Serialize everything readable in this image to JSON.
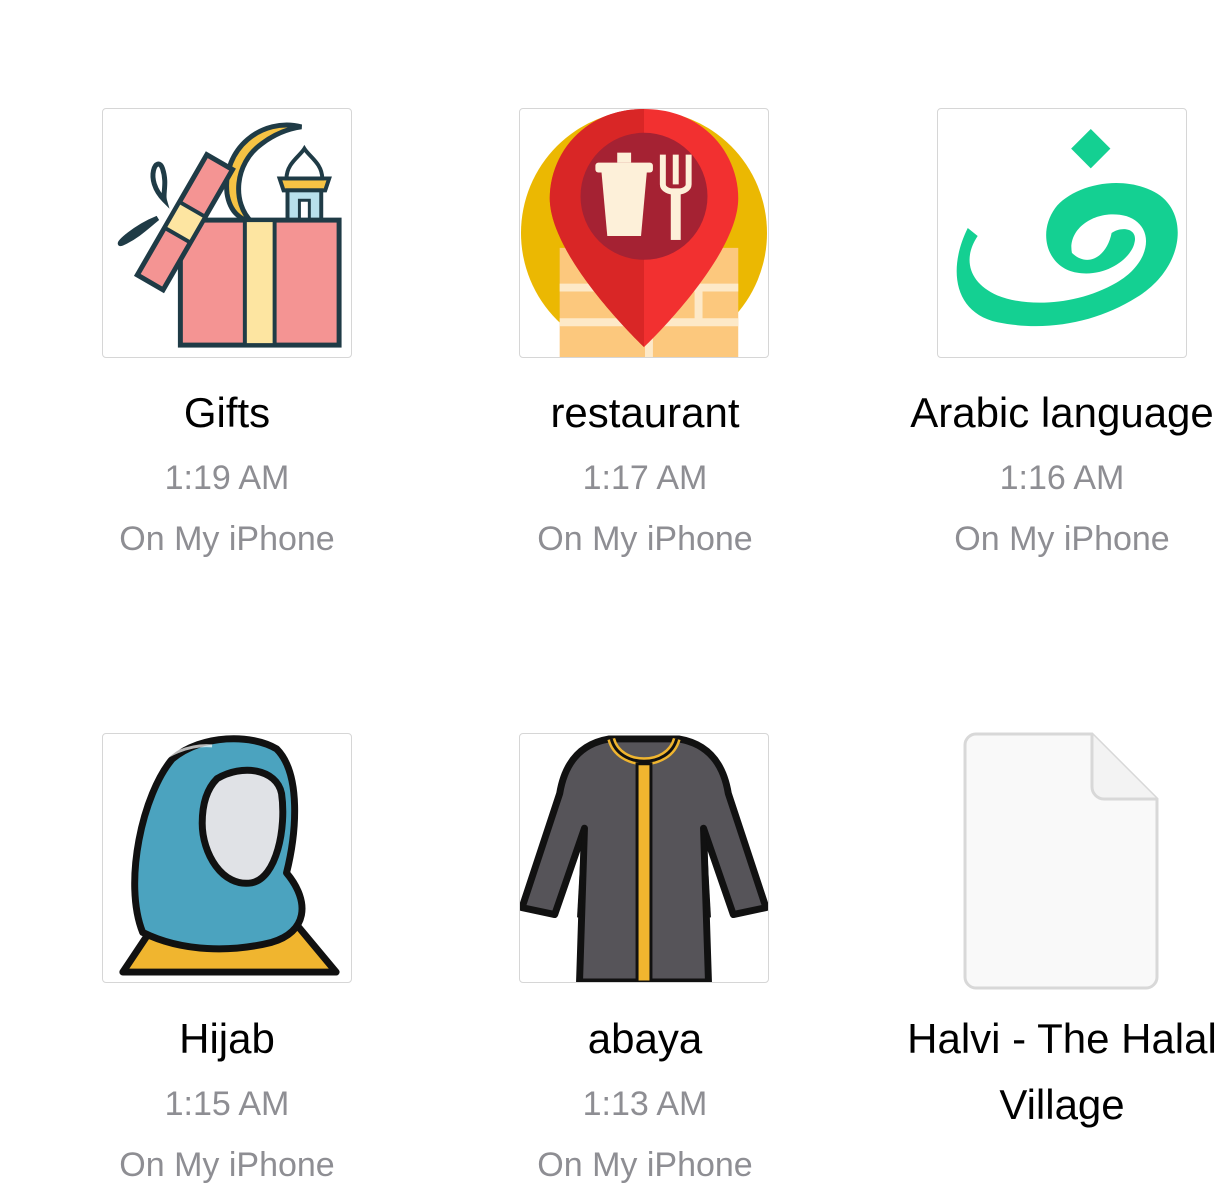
{
  "files": [
    {
      "name": "Gifts",
      "time": "1:19 AM",
      "location": "On My iPhone",
      "thumb_icon": "gift-ramadan-icon"
    },
    {
      "name": "restaurant",
      "time": "1:17 AM",
      "location": "On My iPhone",
      "thumb_icon": "restaurant-pin-icon"
    },
    {
      "name": "Arabic language",
      "time": "1:16 AM",
      "location": "On My iPhone",
      "thumb_icon": "arabic-letter-dad-icon"
    },
    {
      "name": "Hijab",
      "time": "1:15 AM",
      "location": "On My iPhone",
      "thumb_icon": "hijab-woman-icon"
    },
    {
      "name": "abaya",
      "time": "1:13 AM",
      "location": "On My iPhone",
      "thumb_icon": "abaya-robe-icon"
    },
    {
      "name_line1": "Halvi - The Halal",
      "name_line2": "Village",
      "thumb_icon": "blank-document-icon"
    }
  ],
  "arabic_letter": "ض",
  "colors": {
    "secondary_text": "#8e8e93",
    "accent_green": "#14d092"
  }
}
